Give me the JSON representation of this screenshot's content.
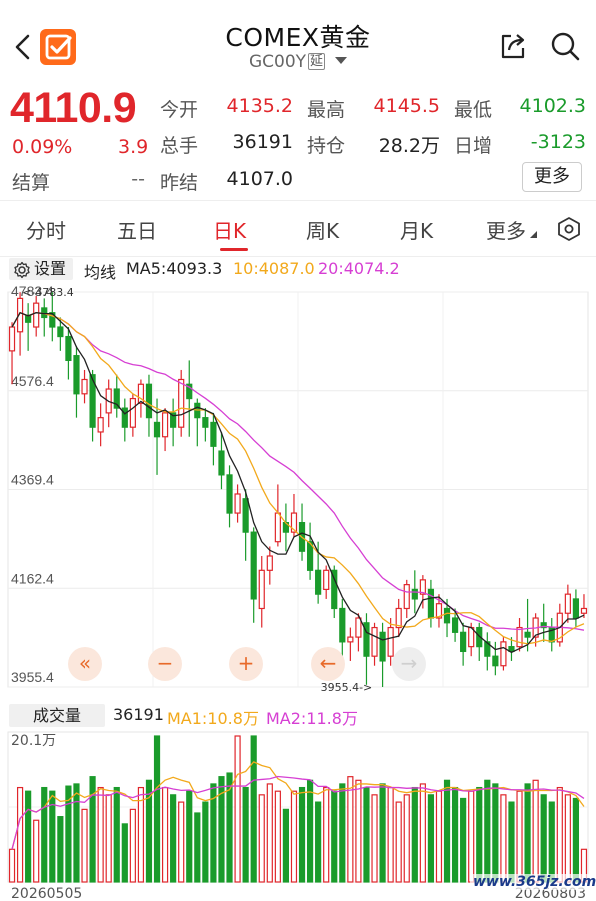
{
  "header": {
    "title": "COMEX黄金",
    "code": "GC00Y",
    "delay_badge": "延"
  },
  "quote": {
    "price": "4110.9",
    "change_pct": "0.09%",
    "change_val": "3.9",
    "settle_label": "结算",
    "settle_value": "--",
    "open_label": "今开",
    "open_value": "4135.2",
    "volume_label": "总手",
    "volume_value": "36191",
    "prevclose_label": "昨结",
    "prevclose_value": "4107.0",
    "high_label": "最高",
    "high_value": "4145.5",
    "oi_label": "持仓",
    "oi_value": "28.2万",
    "low_label": "最低",
    "low_value": "4102.3",
    "oi_change_label": "日增",
    "oi_change_value": "-3123",
    "more_label": "更多"
  },
  "tabs": [
    {
      "label": "分时"
    },
    {
      "label": "五日"
    },
    {
      "label": "日K"
    },
    {
      "label": "周K"
    },
    {
      "label": "月K"
    },
    {
      "label": "更多"
    }
  ],
  "ma_legend": {
    "settings_label": "设置",
    "title": "均线",
    "ma5": "MA5:4093.3",
    "ma10": "10:4087.0",
    "ma20": "20:4074.2"
  },
  "volume_legend": {
    "button_label": "成交量",
    "value": "36191",
    "ma1": "MA1:10.8万",
    "ma2": "MA2:11.8万"
  },
  "float_buttons": [
    "«",
    "−",
    "+",
    "←",
    "→"
  ],
  "watermark": "www.365jz.com",
  "colors": {
    "up": "#e0262b",
    "down": "#1a9b2b",
    "ma5": "#222222",
    "ma10": "#f2a91c",
    "ma20": "#d63fd3"
  },
  "chart_data": {
    "type": "candlestick",
    "y_tick_labels": [
      "4783.4",
      "4576.4",
      "4369.4",
      "4162.4",
      "3955.4"
    ],
    "ylim": [
      3955.4,
      4783.4
    ],
    "max_label": "<-4783.4",
    "min_label": "3955.4->",
    "volume_max_label": "20.1万",
    "x_start_label": "20260505",
    "x_end_label": "20260803",
    "candles": [
      [
        4660,
        4710,
        4590,
        4720
      ],
      [
        4700,
        4770,
        4650,
        4783
      ],
      [
        4735,
        4720,
        4660,
        4760
      ],
      [
        4710,
        4760,
        4690,
        4775
      ],
      [
        4750,
        4730,
        4690,
        4770
      ],
      [
        4740,
        4710,
        4680,
        4783
      ],
      [
        4710,
        4690,
        4660,
        4730
      ],
      [
        4690,
        4640,
        4600,
        4710
      ],
      [
        4650,
        4570,
        4520,
        4670
      ],
      [
        4570,
        4600,
        4550,
        4620
      ],
      [
        4610,
        4500,
        4470,
        4620
      ],
      [
        4490,
        4520,
        4460,
        4550
      ],
      [
        4530,
        4580,
        4500,
        4600
      ],
      [
        4580,
        4540,
        4520,
        4610
      ],
      [
        4540,
        4500,
        4470,
        4560
      ],
      [
        4500,
        4560,
        4480,
        4570
      ],
      [
        4550,
        4590,
        4520,
        4600
      ],
      [
        4590,
        4520,
        4480,
        4610
      ],
      [
        4510,
        4480,
        4400,
        4560
      ],
      [
        4480,
        4530,
        4450,
        4540
      ],
      [
        4530,
        4500,
        4460,
        4560
      ],
      [
        4500,
        4600,
        4480,
        4620
      ],
      [
        4590,
        4560,
        4480,
        4640
      ],
      [
        4550,
        4520,
        4460,
        4560
      ],
      [
        4520,
        4500,
        4470,
        4540
      ],
      [
        4510,
        4460,
        4420,
        4530
      ],
      [
        4450,
        4400,
        4370,
        4490
      ],
      [
        4400,
        4320,
        4290,
        4420
      ],
      [
        4320,
        4360,
        4300,
        4380
      ],
      [
        4350,
        4280,
        4220,
        4370
      ],
      [
        4280,
        4140,
        4090,
        4290
      ],
      [
        4120,
        4200,
        4080,
        4230
      ],
      [
        4200,
        4230,
        4170,
        4250
      ],
      [
        4260,
        4320,
        4250,
        4380
      ],
      [
        4300,
        4280,
        4240,
        4340
      ],
      [
        4280,
        4320,
        4270,
        4360
      ],
      [
        4300,
        4240,
        4220,
        4340
      ],
      [
        4260,
        4200,
        4180,
        4300
      ],
      [
        4200,
        4150,
        4130,
        4260
      ],
      [
        4160,
        4200,
        4140,
        4210
      ],
      [
        4200,
        4120,
        4100,
        4210
      ],
      [
        4120,
        4050,
        4000,
        4140
      ],
      [
        4050,
        4060,
        4010,
        4080
      ],
      [
        4060,
        4100,
        4030,
        4110
      ],
      [
        4090,
        4020,
        3960,
        4110
      ],
      [
        4020,
        4080,
        4000,
        4090
      ],
      [
        4070,
        4010,
        3955.4,
        4090
      ],
      [
        4020,
        4080,
        4000,
        4100
      ],
      [
        4080,
        4120,
        4060,
        4140
      ],
      [
        4120,
        4170,
        4100,
        4180
      ],
      [
        4160,
        4140,
        4110,
        4200
      ],
      [
        4150,
        4180,
        4120,
        4190
      ],
      [
        4160,
        4100,
        4080,
        4180
      ],
      [
        4100,
        4130,
        4080,
        4150
      ],
      [
        4120,
        4090,
        4060,
        4140
      ],
      [
        4100,
        4070,
        4050,
        4120
      ],
      [
        4070,
        4030,
        4000,
        4090
      ],
      [
        4040,
        4080,
        4020,
        4090
      ],
      [
        4080,
        4040,
        4010,
        4090
      ],
      [
        4050,
        4020,
        3990,
        4070
      ],
      [
        4020,
        4000,
        3980,
        4050
      ],
      [
        4000,
        4050,
        3990,
        4060
      ],
      [
        4040,
        4030,
        4010,
        4060
      ],
      [
        4040,
        4080,
        4030,
        4100
      ],
      [
        4070,
        4060,
        4030,
        4140
      ],
      [
        4060,
        4100,
        4040,
        4110
      ],
      [
        4090,
        4080,
        4050,
        4130
      ],
      [
        4080,
        4050,
        4030,
        4100
      ],
      [
        4050,
        4110,
        4040,
        4130
      ],
      [
        4110,
        4150,
        4090,
        4170
      ],
      [
        4140,
        4100,
        4080,
        4160
      ],
      [
        4110,
        4120,
        4100,
        4150
      ]
    ],
    "volume": [
      4.5,
      13.0,
      12.5,
      8.5,
      13.0,
      12.5,
      9.0,
      13.2,
      13.5,
      10.0,
      14.5,
      13.0,
      12.0,
      13.0,
      8.0,
      10.0,
      13.0,
      14.0,
      20.1,
      13.0,
      12.0,
      11.0,
      12.5,
      9.5,
      11.0,
      13.5,
      14.5,
      15.0,
      20.1,
      13.0,
      20.1,
      12.0,
      13.5,
      12.5,
      10.0,
      12.5,
      13.0,
      14.0,
      11.0,
      13.0,
      12.5,
      13.5,
      14.5,
      14.0,
      13.0,
      12.0,
      13.5,
      13.0,
      11.0,
      12.0,
      13.0,
      13.5,
      12.0,
      12.5,
      14.0,
      13.0,
      11.5,
      12.5,
      13.0,
      14.0,
      13.5,
      12.0,
      11.0,
      12.5,
      13.5,
      14.0,
      12.0,
      11.0,
      13.0,
      12.0,
      11.5,
      4.5
    ]
  }
}
